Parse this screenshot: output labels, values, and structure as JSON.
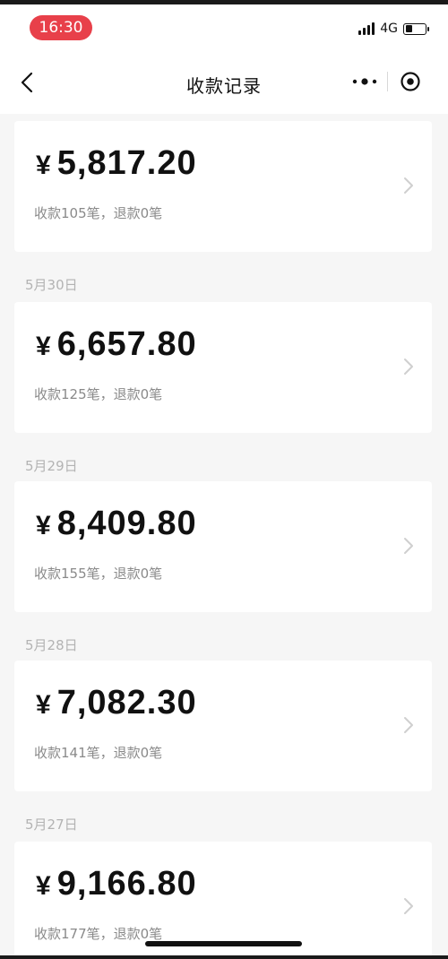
{
  "status_bar": {
    "time": "16:30",
    "network": "4G",
    "time_pill_color": "#e8404a"
  },
  "nav": {
    "title": "收款记录",
    "back_icon": "chevron-left-icon",
    "more_icon": "more-dots-icon",
    "close_icon": "target-circle-icon"
  },
  "records": [
    {
      "date": "",
      "amount": "5,817.20",
      "summary": "收款105笔，退款0笔"
    },
    {
      "date": "5月30日",
      "amount": "6,657.80",
      "summary": "收款125笔，退款0笔"
    },
    {
      "date": "5月29日",
      "amount": "8,409.80",
      "summary": "收款155笔，退款0笔"
    },
    {
      "date": "5月28日",
      "amount": "7,082.30",
      "summary": "收款141笔，退款0笔"
    },
    {
      "date": "5月27日",
      "amount": "9,166.80",
      "summary": "收款177笔，退款0笔"
    }
  ],
  "currency_symbol": "¥"
}
